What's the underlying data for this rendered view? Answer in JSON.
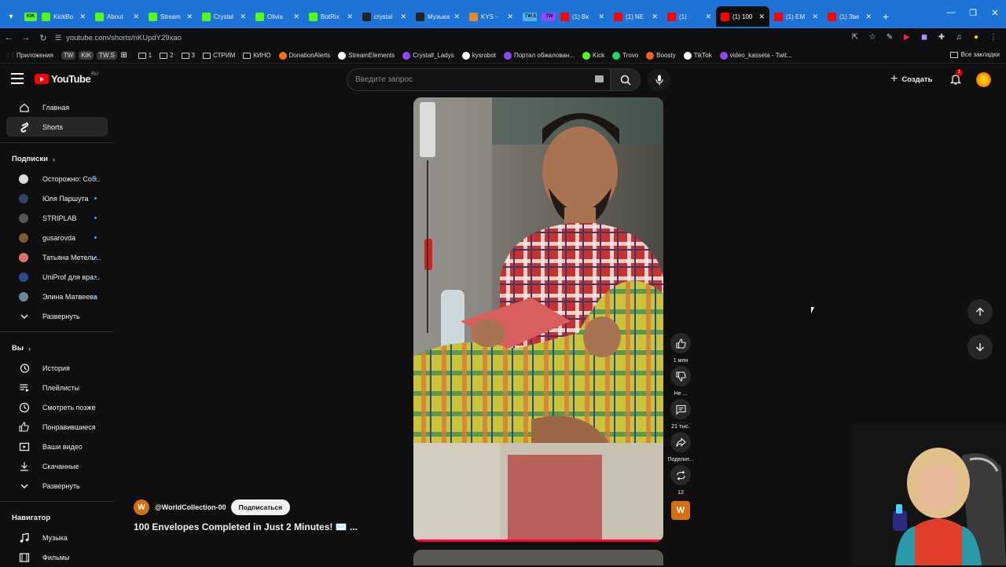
{
  "browser": {
    "tabs": [
      {
        "label": "KIK",
        "color": "#53fc18",
        "active": false
      },
      {
        "label": "KickBo",
        "color": "#53fc18",
        "active": false
      },
      {
        "label": "About",
        "color": "#53fc18",
        "active": false
      },
      {
        "label": "Stream",
        "color": "#53fc18",
        "active": false
      },
      {
        "label": "Crystal",
        "color": "#53fc18",
        "active": false
      },
      {
        "label": "Olivia",
        "color": "#53fc18",
        "active": false
      },
      {
        "label": "BotRix",
        "color": "#53fc18",
        "active": false
      },
      {
        "label": "crystal",
        "color": "#222222",
        "active": false
      },
      {
        "label": "Музыка",
        "color": "#222222",
        "active": false
      },
      {
        "label": "KYS -",
        "color": "#e08a2a",
        "active": false
      },
      {
        "label": "TW.S",
        "color": "#4cb3e8",
        "active": false
      },
      {
        "label": "TW",
        "color": "#9146ff",
        "active": false
      },
      {
        "label": "(1) Вк",
        "color": "#ff0000",
        "active": false
      },
      {
        "label": "(1) NE",
        "color": "#ff0000",
        "active": false
      },
      {
        "label": "(1)",
        "color": "#ff0000",
        "active": false
      },
      {
        "label": "(1) 100",
        "color": "#ff0000",
        "active": true
      },
      {
        "label": "(1) EM",
        "color": "#ff0000",
        "active": false
      },
      {
        "label": "(1) Зве",
        "color": "#ff0000",
        "active": false
      }
    ],
    "url": "youtube.com/shorts/nKUpdY29xao",
    "bookmarks": [
      {
        "label": "Приложения",
        "kind": "apps"
      },
      {
        "label": "TW",
        "kind": "pill"
      },
      {
        "label": "KIK",
        "kind": "pill"
      },
      {
        "label": "TW.S",
        "kind": "pill"
      },
      {
        "label": "",
        "kind": "grid"
      },
      {
        "label": "1",
        "kind": "folder"
      },
      {
        "label": "2",
        "kind": "folder"
      },
      {
        "label": "3",
        "kind": "folder"
      },
      {
        "label": "СТРИМ",
        "kind": "folder"
      },
      {
        "label": "КИНО",
        "kind": "folder"
      },
      {
        "label": "DonationAlerts",
        "kind": "site",
        "color": "#f57507"
      },
      {
        "label": "StreamElements",
        "kind": "site",
        "color": "#ffffff"
      },
      {
        "label": "Crystall_Ladys",
        "kind": "site",
        "color": "#9146ff"
      },
      {
        "label": "kysrobot",
        "kind": "site",
        "color": "#ffffff"
      },
      {
        "label": "Портал обжалован...",
        "kind": "site",
        "color": "#9146ff"
      },
      {
        "label": "Kick",
        "kind": "site",
        "color": "#53fc18"
      },
      {
        "label": "Trovo",
        "kind": "site",
        "color": "#19d66b"
      },
      {
        "label": "Boosty",
        "kind": "site",
        "color": "#f15f2c"
      },
      {
        "label": "TikTok",
        "kind": "site",
        "color": "#ffffff"
      },
      {
        "label": "video_kasseta - Twit...",
        "kind": "site",
        "color": "#9146ff"
      }
    ],
    "all_bookmarks": "Все закладки"
  },
  "youtube": {
    "logo": "YouTube",
    "region": "RU",
    "search_placeholder": "Введите запрос",
    "create_label": "Создать",
    "notif_count": "1",
    "sidebar": {
      "main": [
        {
          "label": "Главная",
          "icon": "home-icon"
        },
        {
          "label": "Shorts",
          "icon": "shorts-icon",
          "selected": true
        }
      ],
      "subs_title": "Подписки",
      "subs": [
        {
          "label": "Осторожно: Соб...",
          "color": "#dddddd"
        },
        {
          "label": "Юля Паршута",
          "color": "#334466"
        },
        {
          "label": "STRIPLAB",
          "color": "#555555"
        },
        {
          "label": "gusarovda",
          "color": "#7a5a3a"
        },
        {
          "label": "Татьяна Метель...",
          "color": "#e07070"
        },
        {
          "label": "UniProf для вра...",
          "color": "#2a4a8a"
        },
        {
          "label": "Элина Матвеева",
          "color": "#6a8a9a"
        }
      ],
      "subs_expand": "Развернуть",
      "you_title": "Вы",
      "you": [
        {
          "label": "История",
          "icon": "history-icon"
        },
        {
          "label": "Плейлисты",
          "icon": "playlists-icon"
        },
        {
          "label": "Смотреть позже",
          "icon": "watch-later-icon"
        },
        {
          "label": "Понравившиеся",
          "icon": "liked-icon"
        },
        {
          "label": "Ваши видео",
          "icon": "your-videos-icon"
        },
        {
          "label": "Скачанные",
          "icon": "downloads-icon"
        }
      ],
      "you_expand": "Развернуть",
      "nav_title": "Навигатор",
      "nav": [
        {
          "label": "Музыка",
          "icon": "music-icon"
        },
        {
          "label": "Фильмы",
          "icon": "movies-icon"
        }
      ]
    },
    "short": {
      "channel_initial": "W",
      "channel": "@WorldCollection-00",
      "subscribe_label": "Подписаться",
      "title": "100 Envelopes Completed in Just 2 Minutes! ✉️ ...",
      "likes": "1 млн",
      "dislike_label": "Не ...",
      "comments": "21 тыс.",
      "share_label": "Поделит...",
      "remix_count": "12"
    }
  }
}
